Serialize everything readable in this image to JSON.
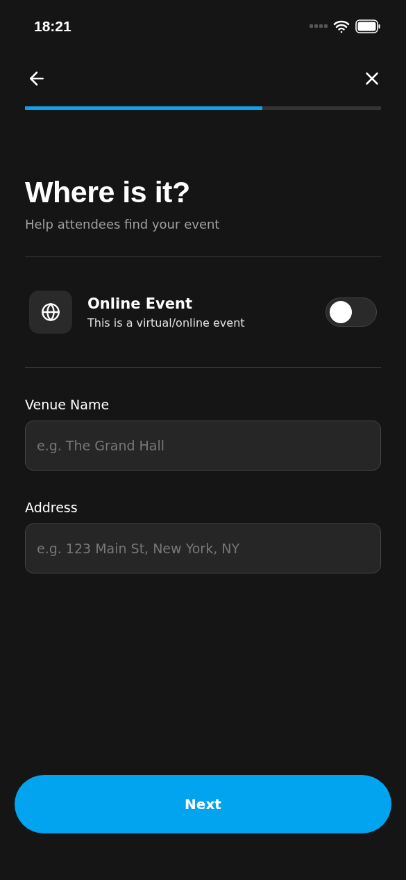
{
  "status_bar": {
    "time": "18:21"
  },
  "progress": {
    "level": 0.667
  },
  "header": {
    "title": "Where is it?",
    "subtitle": "Help attendees find your event"
  },
  "online_option": {
    "title": "Online Event",
    "description": "This is a virtual/online event",
    "on": false
  },
  "fields": [
    {
      "label": "Venue Name",
      "placeholder": "e.g. The Grand Hall"
    },
    {
      "label": "Address",
      "placeholder": "e.g. 123 Main St, New York, NY"
    }
  ],
  "primary_button": {
    "label": "Next"
  }
}
